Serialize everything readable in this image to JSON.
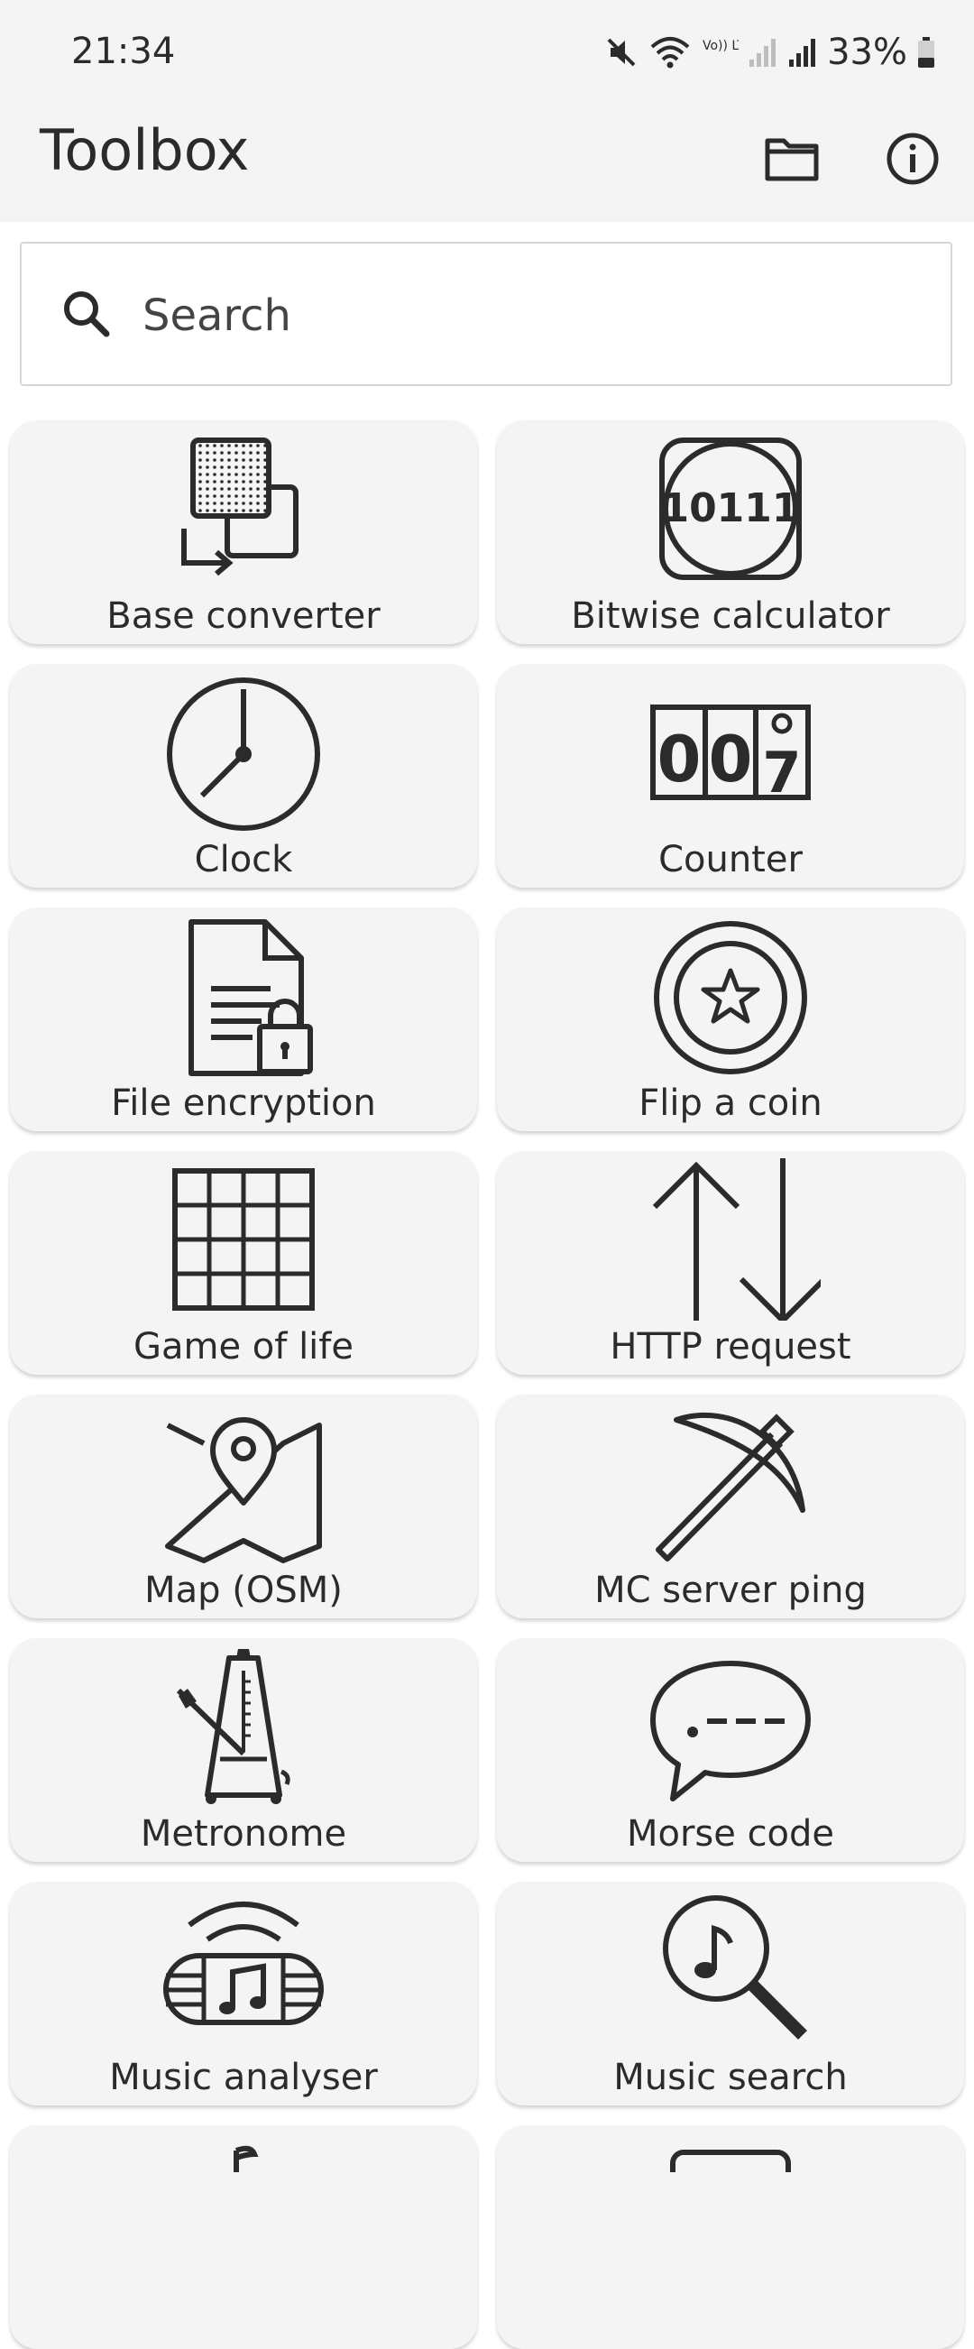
{
  "status_bar": {
    "time": "21:34",
    "battery": "33%",
    "network_label": "Vo)) LTE1",
    "icons": [
      "mute-icon",
      "wifi-icon",
      "volte-icon",
      "signal-icon",
      "signal-icon",
      "battery-icon"
    ]
  },
  "app_bar": {
    "title": "Toolbox",
    "actions": [
      "folder-icon",
      "info-icon"
    ]
  },
  "search": {
    "placeholder": "Search",
    "value": ""
  },
  "tools": [
    {
      "label": "Base converter",
      "icon": "base-converter-icon"
    },
    {
      "label": "Bitwise calculator",
      "icon": "bitwise-calculator-icon",
      "icon_text": "10111"
    },
    {
      "label": "Clock",
      "icon": "clock-icon"
    },
    {
      "label": "Counter",
      "icon": "counter-icon",
      "icon_text": "007"
    },
    {
      "label": "File encryption",
      "icon": "file-lock-icon"
    },
    {
      "label": "Flip a coin",
      "icon": "coin-star-icon"
    },
    {
      "label": "Game of life",
      "icon": "grid-icon"
    },
    {
      "label": "HTTP request",
      "icon": "up-down-arrows-icon"
    },
    {
      "label": "Map (OSM)",
      "icon": "map-pin-icon"
    },
    {
      "label": "MC server ping",
      "icon": "pickaxe-icon"
    },
    {
      "label": "Metronome",
      "icon": "metronome-icon"
    },
    {
      "label": "Morse code",
      "icon": "speech-bubble-morse-icon",
      "icon_text": ".---"
    },
    {
      "label": "Music analyser",
      "icon": "radio-music-icon"
    },
    {
      "label": "Music search",
      "icon": "music-search-icon"
    }
  ],
  "colors": {
    "background": "#ffffff",
    "bar": "#f4f4f4",
    "tile": "#f4f4f4",
    "text": "#2b2b2b"
  }
}
